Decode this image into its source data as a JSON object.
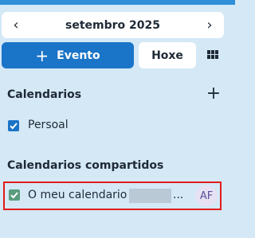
{
  "navigation": {
    "prev_icon": "chevron-left-icon",
    "next_icon": "chevron-right-icon",
    "month_label": "setembro 2025"
  },
  "toolbar": {
    "new_event_label": "Evento",
    "today_label": "Hoxe",
    "view_icon": "grid-icon"
  },
  "calendars": {
    "title": "Calendarios",
    "add_icon": "plus-icon",
    "items": [
      {
        "label": "Persoal",
        "checked": true,
        "color": "#1a74c7"
      }
    ]
  },
  "shared_calendars": {
    "title": "Calendarios compartidos",
    "items": [
      {
        "label": "O meu calendario",
        "suffix": "...",
        "checked": true,
        "color": "#5a9c7e",
        "owner_initials": "AF"
      }
    ]
  },
  "colors": {
    "accent": "#1a74c7",
    "background": "#d4e8f6",
    "highlight": "#e21b1b"
  }
}
